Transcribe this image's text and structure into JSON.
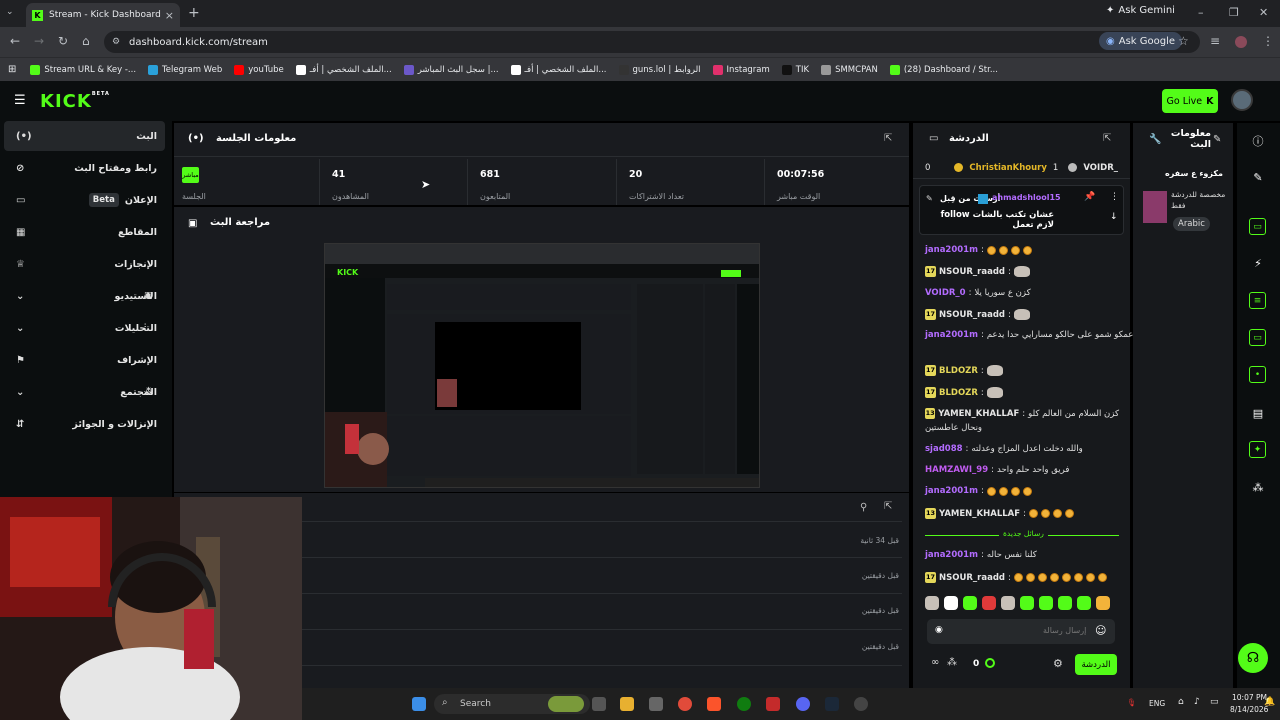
{
  "browser": {
    "tab_title": "Stream - Kick Dashboard",
    "url": "dashboard.kick.com/stream",
    "ask_gemini": "Ask Gemini",
    "ask_google": "Ask Google",
    "bookmarks": [
      {
        "label": "Stream URL & Key -...",
        "color": "#53fc18"
      },
      {
        "label": "Telegram Web",
        "color": "#2aa1da"
      },
      {
        "label": "youTube",
        "color": "#ff0000"
      },
      {
        "label": "الملف الشخصي | أفـ...",
        "color": "#ffffff"
      },
      {
        "label": "سجل البث المباشر |...",
        "color": "#6b58c9"
      },
      {
        "label": "الملف الشخصي | أفـ...",
        "color": "#ffffff"
      },
      {
        "label": "guns.lol | الروابط",
        "color": "#333333"
      },
      {
        "label": "Instagram",
        "color": "#e1306c"
      },
      {
        "label": "TIK",
        "color": "#111111"
      },
      {
        "label": "SMMCPAN",
        "color": "#999999"
      },
      {
        "label": "(28) Dashboard / Str...",
        "color": "#53fc18"
      }
    ]
  },
  "kick": {
    "logo": "KICK",
    "logo_badge": "BETA",
    "go_live": "Go Live",
    "accent": "#53fc18"
  },
  "sidebar": {
    "items": [
      {
        "label": "البث"
      },
      {
        "label": "رابط ومفتاح البث"
      },
      {
        "label": "الإعلان",
        "badge": "Beta"
      },
      {
        "label": "المقاطع"
      },
      {
        "label": "الإنجازات"
      },
      {
        "label": "الاستيديو"
      },
      {
        "label": "التحليلات"
      },
      {
        "label": "الإشراف"
      },
      {
        "label": "المجتمع"
      },
      {
        "label": "الإنزالات و الجوائز"
      }
    ]
  },
  "session": {
    "title": "معلومات الجلسة",
    "live_badge": "مباشر",
    "live_label": "الجلسة",
    "stats": [
      {
        "value": "41",
        "label": "المشاهدون"
      },
      {
        "value": "681",
        "label": "المتابعون"
      },
      {
        "value": "20",
        "label": "تعداد الاشتراكات"
      },
      {
        "value": "00:07:56",
        "label": "الوقت مباشر"
      }
    ]
  },
  "review": {
    "title": "مراجعة البث"
  },
  "activity": {
    "rows": [
      "قبل 34 ثانية",
      "قبل دقيقتين",
      "قبل دقيقتين",
      "قبل دقيقتين"
    ]
  },
  "chat": {
    "title": "الدردشة",
    "top_count": "0",
    "top_users": [
      "ChristianKhoury",
      "1",
      "VOIDR_"
    ],
    "pinned_user": "ahmadshlool15",
    "pinned_by": "أرسلت من قِبل",
    "pinned_text": "عشان تكتب بالشات follow لازم تعمل",
    "messages": [
      {
        "user": "jana2001m",
        "color": "#b36cff",
        "text": "",
        "emotes": 4
      },
      {
        "user": "NSOUR_raadd",
        "color": "#e6e6e6",
        "badge": "17",
        "text": "",
        "pepe": true
      },
      {
        "user": "VOIDR_0",
        "color": "#b36cff",
        "text": "كزن ع سوريا يلا"
      },
      {
        "user": "NSOUR_raadd",
        "color": "#e6e6e6",
        "badge": "17",
        "text": "",
        "pepe": true
      },
      {
        "user": "jana2001m",
        "color": "#b36cff",
        "text": "دعمكو شمو على حالكو مسارايي حدا يدعم"
      },
      {
        "user": "BLDOZR",
        "color": "#e4d75a",
        "badge": "17",
        "text": "",
        "pepe": true
      },
      {
        "user": "BLDOZR",
        "color": "#e4d75a",
        "badge": "17",
        "text": "",
        "pepe": true
      },
      {
        "user": "YAMEN_KHALLAF",
        "color": "#e6e6e6",
        "badge": "13",
        "text": "كزن السلام من العالم كلو"
      },
      {
        "user": "sjad088",
        "color": "#b36cff",
        "text": "والله دخلت اعدل المزاج وعدلته"
      },
      {
        "user": "HAMZAWI_99",
        "color": "#c05cf0",
        "text": "فريق واحد حلم واحد"
      },
      {
        "user": "jana2001m",
        "color": "#b36cff",
        "text": "",
        "emotes": 4
      },
      {
        "user": "YAMEN_KHALLAF",
        "color": "#e6e6e6",
        "badge": "13",
        "text": "",
        "emotes": 4
      },
      {
        "user": "jana2001m",
        "color": "#b36cff",
        "text": "كلنا نفس حاله"
      },
      {
        "user": "NSOUR_raadd",
        "color": "#e6e6e6",
        "badge": "17",
        "text": "",
        "emotes": 8
      }
    ],
    "wrap_line": "ونحال عاطستين",
    "new_messages": "رسائل جديدة",
    "input_placeholder": "إرسال رسالة",
    "send_label": "الدردشة",
    "bottom_count": "0"
  },
  "stream_info": {
    "title": "معلومات البث",
    "stream_title": "مكزوء ع سفره",
    "category_line": "مخصصة للدردشة فقط",
    "language": "Arabic"
  },
  "taskbar": {
    "search": "Search",
    "lang": "ENG",
    "time": "10:07 PM",
    "date": "8/14/2026"
  }
}
